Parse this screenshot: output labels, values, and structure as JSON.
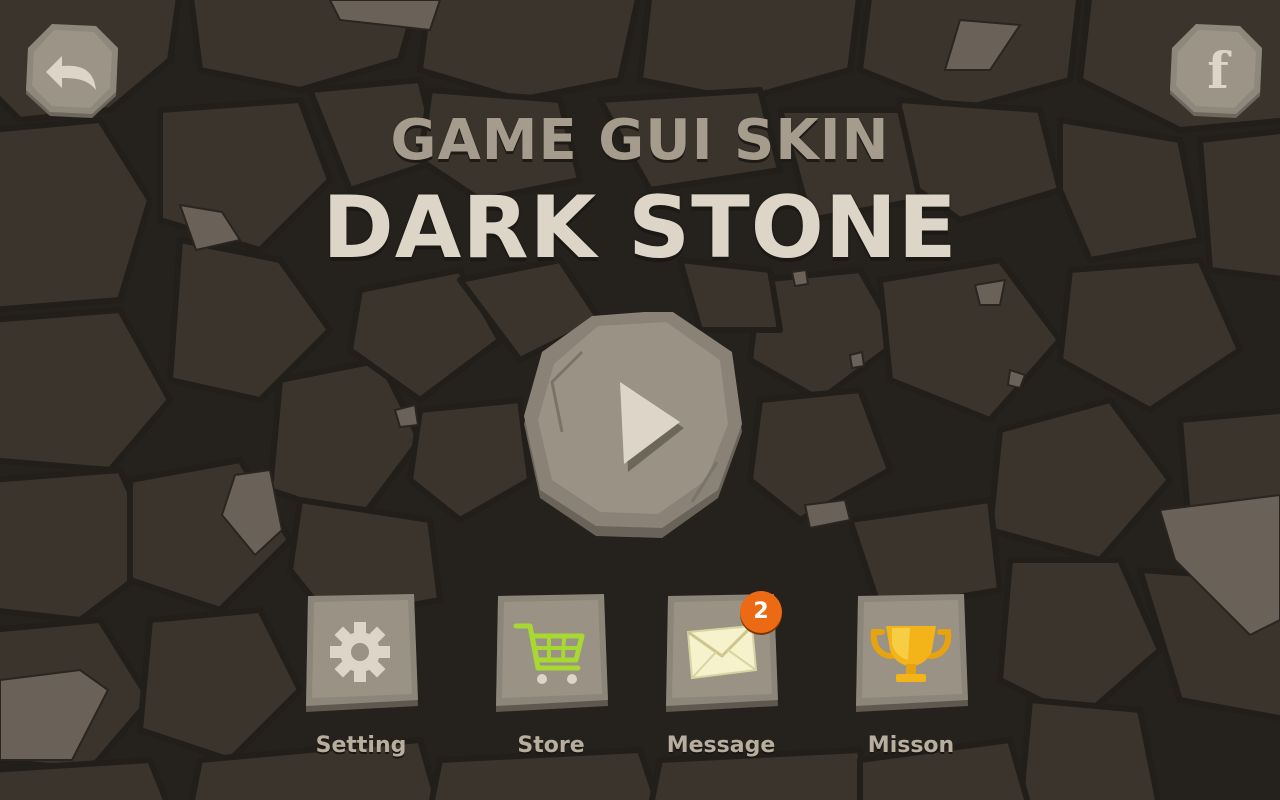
{
  "title": {
    "line1": "GAME GUI SKIN",
    "line2": "DARK STONE"
  },
  "top_bar": {
    "back_icon": "back-arrow-icon",
    "facebook_icon": "facebook-icon",
    "facebook_glyph": "f"
  },
  "play": {
    "icon": "play-icon"
  },
  "menu": [
    {
      "label": "Setting",
      "icon": "gear-icon"
    },
    {
      "label": "Store",
      "icon": "shopping-cart-icon"
    },
    {
      "label": "Message",
      "icon": "envelope-icon",
      "badge": "2"
    },
    {
      "label": "Misson",
      "icon": "trophy-icon"
    }
  ],
  "colors": {
    "background": "#2f2a24",
    "stone": "#8c8477",
    "title_light": "#ddd6c8",
    "title_dim": "#a59c8d",
    "badge": "#ec6a14",
    "cart": "#a8d832",
    "trophy": "#f2b418"
  }
}
